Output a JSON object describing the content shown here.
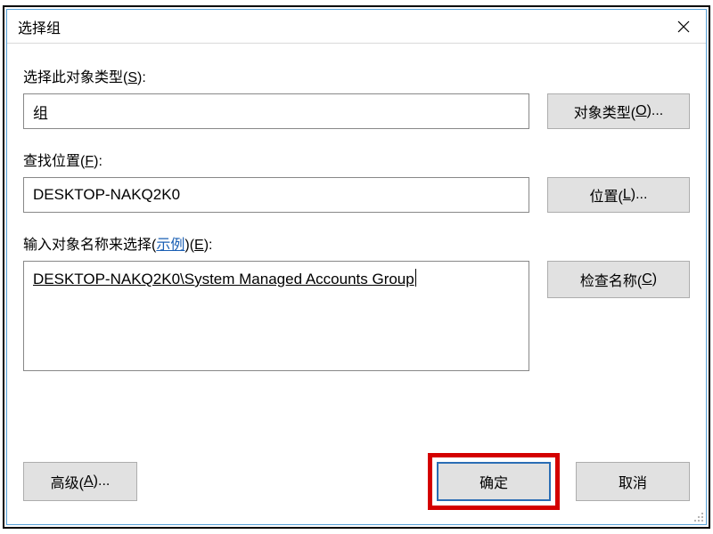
{
  "window": {
    "title": "选择组"
  },
  "labels": {
    "object_type_label": "选择此对象类型(",
    "object_type_hotkey": "S",
    "object_type_suffix": "):",
    "location_label": "查找位置(",
    "location_hotkey": "F",
    "location_suffix": "):",
    "names_label_prefix": "输入对象名称来选择(",
    "names_example_link": "示例",
    "names_label_mid": ")(",
    "names_hotkey": "E",
    "names_label_suffix": "):"
  },
  "values": {
    "object_type": "组",
    "location": "DESKTOP-NAKQ2K0",
    "object_name": "DESKTOP-NAKQ2K0\\System Managed Accounts Group"
  },
  "buttons": {
    "object_types": "对象类型(",
    "object_types_hotkey": "O",
    "object_types_suffix": ")...",
    "locations": "位置(",
    "locations_hotkey": "L",
    "locations_suffix": ")...",
    "check_names": "检查名称(",
    "check_names_hotkey": "C",
    "check_names_suffix": ")",
    "advanced": "高级(",
    "advanced_hotkey": "A",
    "advanced_suffix": ")...",
    "ok": "确定",
    "cancel": "取消"
  }
}
